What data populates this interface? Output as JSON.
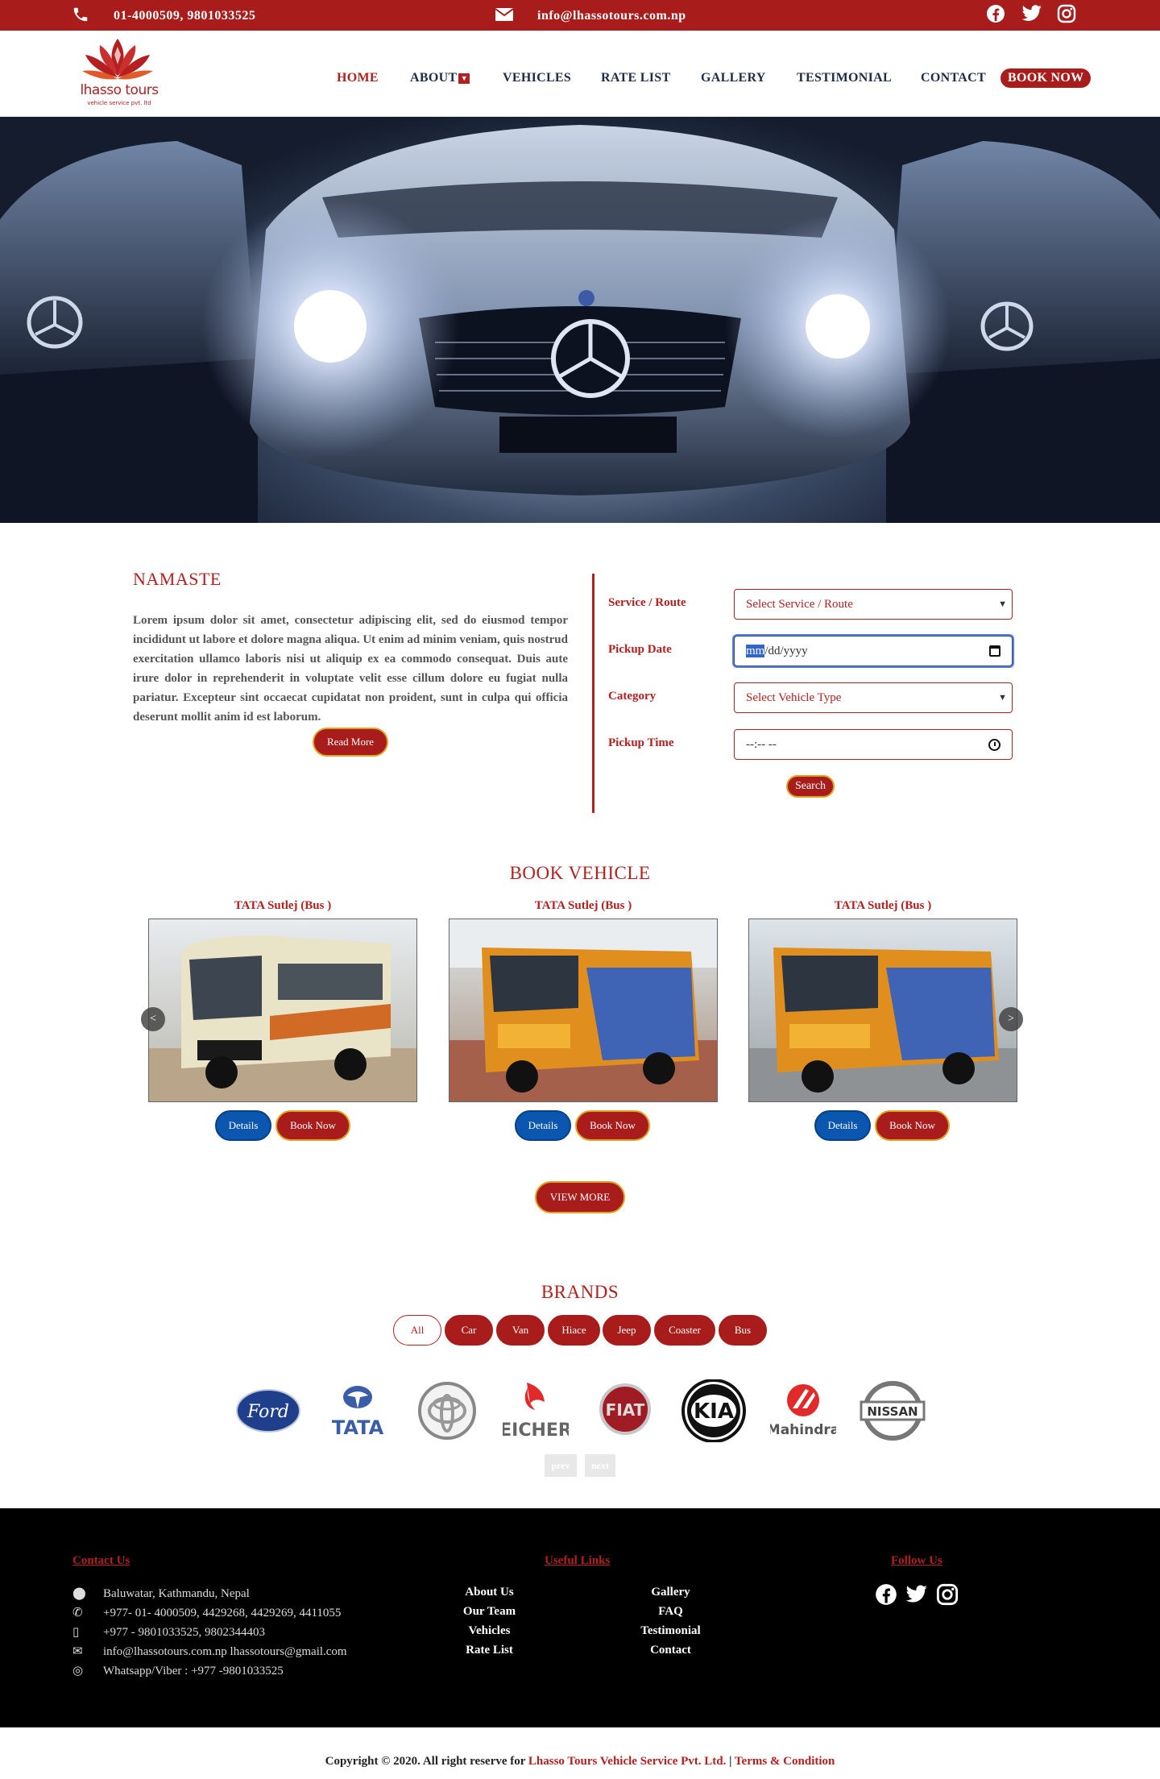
{
  "topbar": {
    "phone": "01-4000509, 9801033525",
    "email": "info@lhassotours.com.np",
    "social": [
      "facebook-icon",
      "twitter-icon",
      "instagram-icon"
    ]
  },
  "logo": {
    "name": "lhasso tours",
    "tagline": "vehicle service pvt. ltd"
  },
  "nav": {
    "home": "HOME",
    "about": "ABOUT",
    "vehicles": "VEHICLES",
    "rate_list": "RATE LIST",
    "gallery": "GALLERY",
    "testimonial": "TESTIMONIAL",
    "contact": "CONTACT",
    "book_now": "BOOK NOW"
  },
  "intro": {
    "title": "NAMASTE",
    "text": "Lorem ipsum dolor sit amet, consectetur adipiscing elit, sed do eiusmod tempor incididunt ut labore et dolore magna aliqua. Ut enim ad minim veniam, quis nostrud exercitation ullamco laboris nisi ut aliquip ex ea commodo consequat. Duis aute irure dolor in reprehenderit in voluptate velit esse cillum dolore eu fugiat nulla pariatur. Excepteur sint occaecat cupidatat non proident, sunt in culpa qui officia deserunt mollit anim id est laborum.",
    "read_more": "Read More"
  },
  "form": {
    "service_label": "Service / Route",
    "service_value": "Select Service / Route",
    "date_label": "Pickup Date",
    "date_mm": "mm",
    "date_rest": "/dd/yyyy",
    "category_label": "Category",
    "category_value": "Select Vehicle Type",
    "time_label": "Pickup Time",
    "time_value": "--:-- --",
    "search": "Search"
  },
  "book_vehicle": {
    "title": "BOOK VEHICLE",
    "cards": [
      {
        "name": "TATA Sutlej (Bus )",
        "details": "Details",
        "book": "Book Now"
      },
      {
        "name": "TATA Sutlej (Bus )",
        "details": "Details",
        "book": "Book Now"
      },
      {
        "name": "TATA Sutlej (Bus )",
        "details": "Details",
        "book": "Book Now"
      }
    ],
    "prev": "<",
    "next": ">",
    "view_more": "VIEW MORE"
  },
  "brands": {
    "title": "BRANDS",
    "filters": [
      "All",
      "Car",
      "Van",
      "Hiace",
      "Jeep",
      "Coaster",
      "Bus"
    ],
    "logos": [
      "Ford",
      "TATA",
      "Toyota",
      "EICHER",
      "FIAT",
      "KIA",
      "Mahindra",
      "NISSAN"
    ],
    "prev": "prev",
    "next": "next"
  },
  "footer": {
    "contact_title": "Contact Us",
    "address": "Baluwatar, Kathmandu, Nepal",
    "phone": "+977- 01- 4000509, 4429268, 4429269, 4411055",
    "mobile": "+977 - 9801033525, 9802344403",
    "email": "info@lhassotours.com.np lhassotours@gmail.com",
    "whatsapp": "Whatsapp/Viber : +977 -9801033525",
    "links_title": "Useful Links",
    "links": [
      "About Us",
      "Our Team",
      "Vehicles",
      "Rate List",
      "Gallery",
      "FAQ",
      "Testimonial",
      "Contact"
    ],
    "follow_title": "Follow Us"
  },
  "copyright": {
    "prefix": "Copyright © 2020. All right reserve for",
    "company": "Lhasso Tours Vehicle Service Pvt. Ltd.",
    "sep": "|",
    "terms": "Terms & Condition"
  },
  "colors": {
    "brand_red": "#a81d1c",
    "button_blue": "#0b57b0",
    "footer_bg": "#000000"
  }
}
